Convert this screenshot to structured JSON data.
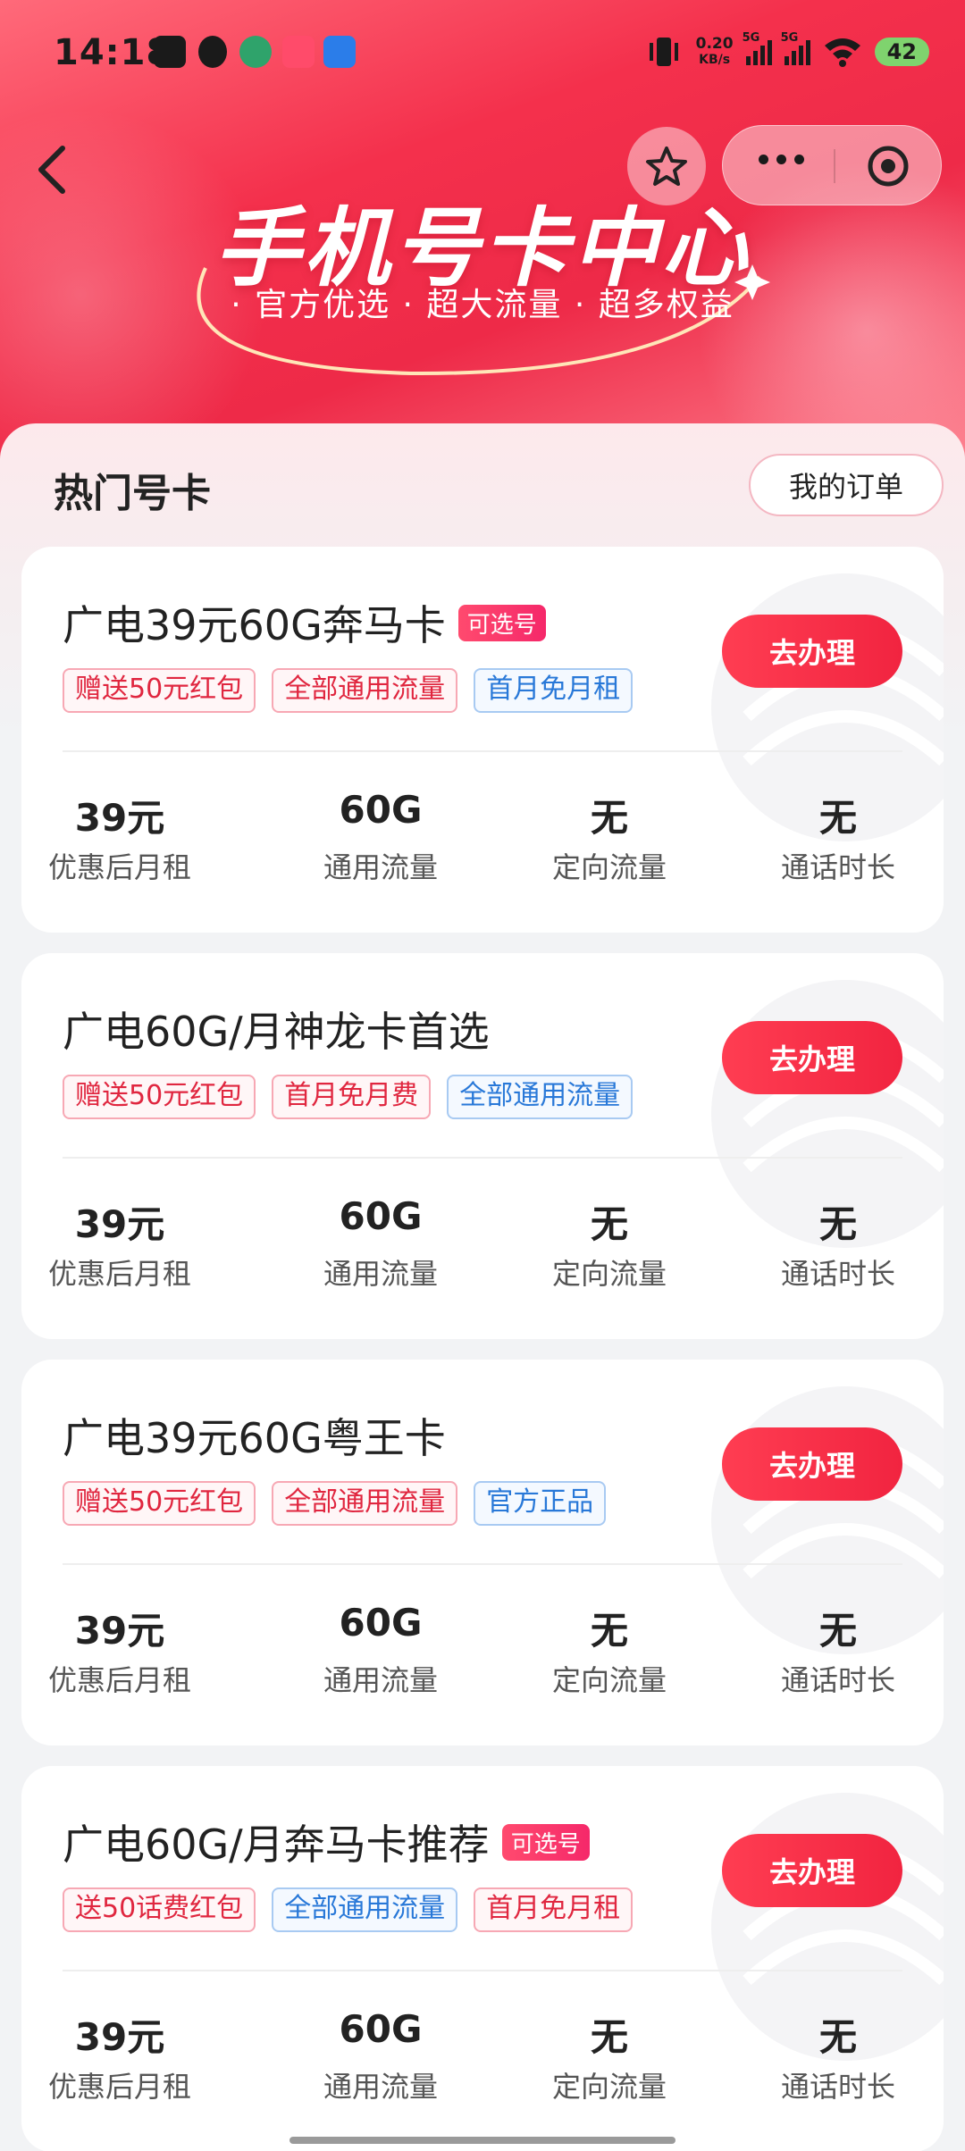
{
  "status_bar": {
    "time": "14:18",
    "net_speed_top": "0.20",
    "net_speed_bottom": "KB/s",
    "signal_1_label": "5G",
    "signal_2_label": "5G",
    "battery": "42"
  },
  "header": {
    "title": "手机号卡中心",
    "subtitle": "· 官方优选 · 超大流量 · 超多权益"
  },
  "section": {
    "title": "热门号卡",
    "order_button": "我的订单"
  },
  "cards": [
    {
      "name": "广电39元60G奔马卡",
      "badge": "可选号",
      "tags": [
        {
          "text": "赠送50元红包",
          "color": "red"
        },
        {
          "text": "全部通用流量",
          "color": "red"
        },
        {
          "text": "首月免月租",
          "color": "blue"
        }
      ],
      "button": "去办理",
      "stats": [
        {
          "value": "39元",
          "label": "优惠后月租"
        },
        {
          "value": "60G",
          "label": "通用流量"
        },
        {
          "value": "无",
          "label": "定向流量"
        },
        {
          "value": "无",
          "label": "通话时长"
        }
      ]
    },
    {
      "name": "广电60G/月神龙卡首选",
      "badge": "",
      "tags": [
        {
          "text": "赠送50元红包",
          "color": "red"
        },
        {
          "text": "首月免月费",
          "color": "red"
        },
        {
          "text": "全部通用流量",
          "color": "blue"
        }
      ],
      "button": "去办理",
      "stats": [
        {
          "value": "39元",
          "label": "优惠后月租"
        },
        {
          "value": "60G",
          "label": "通用流量"
        },
        {
          "value": "无",
          "label": "定向流量"
        },
        {
          "value": "无",
          "label": "通话时长"
        }
      ]
    },
    {
      "name": "广电39元60G粤王卡",
      "badge": "",
      "tags": [
        {
          "text": "赠送50元红包",
          "color": "red"
        },
        {
          "text": "全部通用流量",
          "color": "red"
        },
        {
          "text": "官方正品",
          "color": "blue"
        }
      ],
      "button": "去办理",
      "stats": [
        {
          "value": "39元",
          "label": "优惠后月租"
        },
        {
          "value": "60G",
          "label": "通用流量"
        },
        {
          "value": "无",
          "label": "定向流量"
        },
        {
          "value": "无",
          "label": "通话时长"
        }
      ]
    },
    {
      "name": "广电60G/月奔马卡推荐",
      "badge": "可选号",
      "tags": [
        {
          "text": "送50话费红包",
          "color": "red"
        },
        {
          "text": "全部通用流量",
          "color": "blue"
        },
        {
          "text": "首月免月租",
          "color": "red"
        }
      ],
      "button": "去办理",
      "stats": [
        {
          "value": "39元",
          "label": "优惠后月租"
        },
        {
          "value": "60G",
          "label": "通用流量"
        },
        {
          "value": "无",
          "label": "定向流量"
        },
        {
          "value": "无",
          "label": "通话时长"
        }
      ]
    }
  ],
  "colors": {
    "accent": "#f12440",
    "tag_red": "#e0263f",
    "tag_blue": "#2878d8"
  }
}
